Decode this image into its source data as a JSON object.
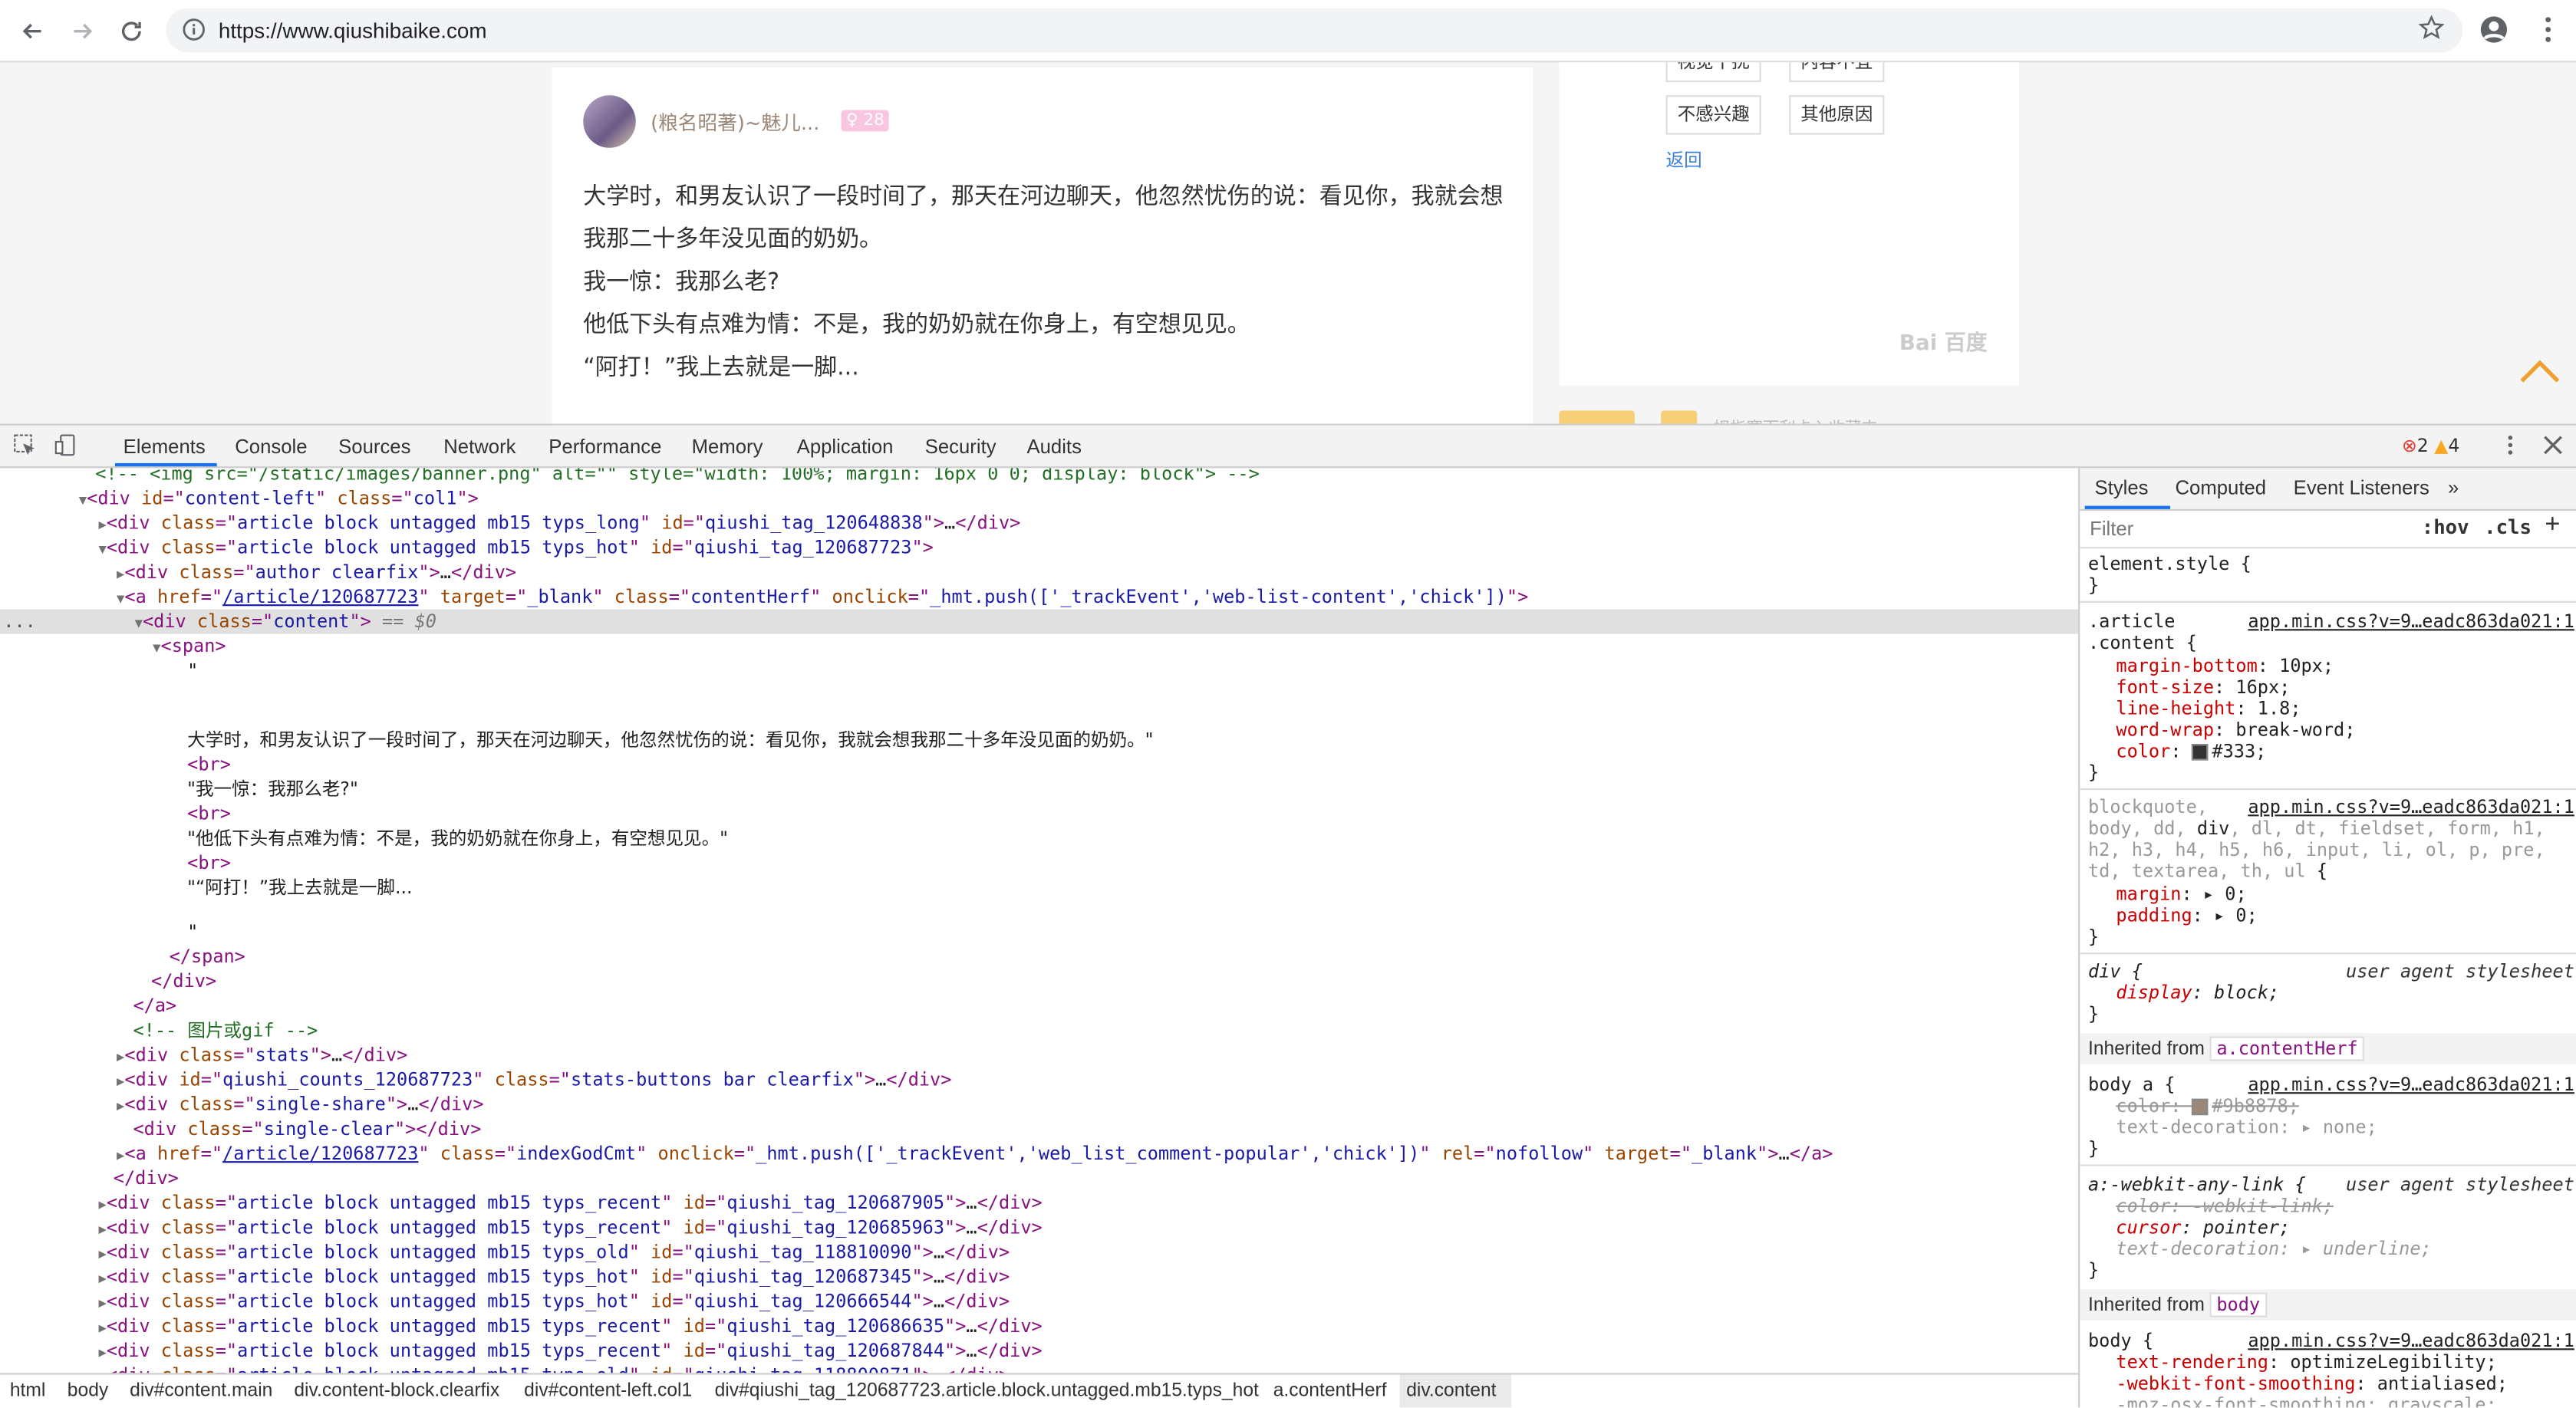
{
  "browser": {
    "url": "https://www.qiushibaike.com"
  },
  "page": {
    "author_name": "(粮名昭著)~魅儿...",
    "level": "28",
    "paragraphs": [
      "大学时，和男友认识了一段时间了，那天在河边聊天，他忽然忧伤的说：看见你，我就会想我那二十多年没见面的奶奶。",
      "我一惊：我那么老?",
      "他低下头有点难为情：不是，我的奶奶就在你身上，有空想见见。",
      "“阿打！”我上去就是一脚..."
    ],
    "reasons": [
      "视觉干扰",
      "内容不宜",
      "不感兴趣",
      "其他原因"
    ],
    "back_label": "返回",
    "baidu_mark": "Bai 百度",
    "bottom_peek_text": "拇指赛而利卡入收藏夹"
  },
  "devtools": {
    "tabs": [
      "Elements",
      "Console",
      "Sources",
      "Network",
      "Performance",
      "Memory",
      "Application",
      "Security",
      "Audits"
    ],
    "errors": "2",
    "warnings": "4",
    "dom": {
      "l0": "<!-- <img src=\"/static/images/banner.png\" alt=\"\" style=\"width: 100%; margin: 16px 0 0; display: block\"> -->",
      "text1": "大学时，和男友认识了一段时间了，那天在河边聊天，他忽然忧伤的说：看见你，我就会想我那二十多年没见面的奶奶。\"",
      "text2": "\"我一惊：我那么老?\"",
      "text3": "\"他低下头有点难为情：不是，我的奶奶就在你身上，有空想见见。\"",
      "text4": "\"“阿打！”我上去就是一脚...",
      "comment_img": "<!-- 图片或gif -->",
      "selected_marker": "== $0"
    },
    "breadcrumbs": [
      "html",
      "body",
      "div#content.main",
      "div.content-block.clearfix",
      "div#content-left.col1",
      "div#qiushi_tag_120687723.article.block.untagged.mb15.typs_hot",
      "a.contentHerf",
      "div.content"
    ],
    "styles": {
      "tabs": [
        "Styles",
        "Computed",
        "Event Listeners"
      ],
      "filter_placeholder": "Filter",
      "hov": ":hov",
      "cls": ".cls",
      "src": "app.min.css?v=9…eadc863da021:1",
      "ua": "user agent stylesheet",
      "inherited_from": "Inherited from",
      "inherited_a": "a.contentHerf",
      "inherited_body": "body"
    }
  }
}
